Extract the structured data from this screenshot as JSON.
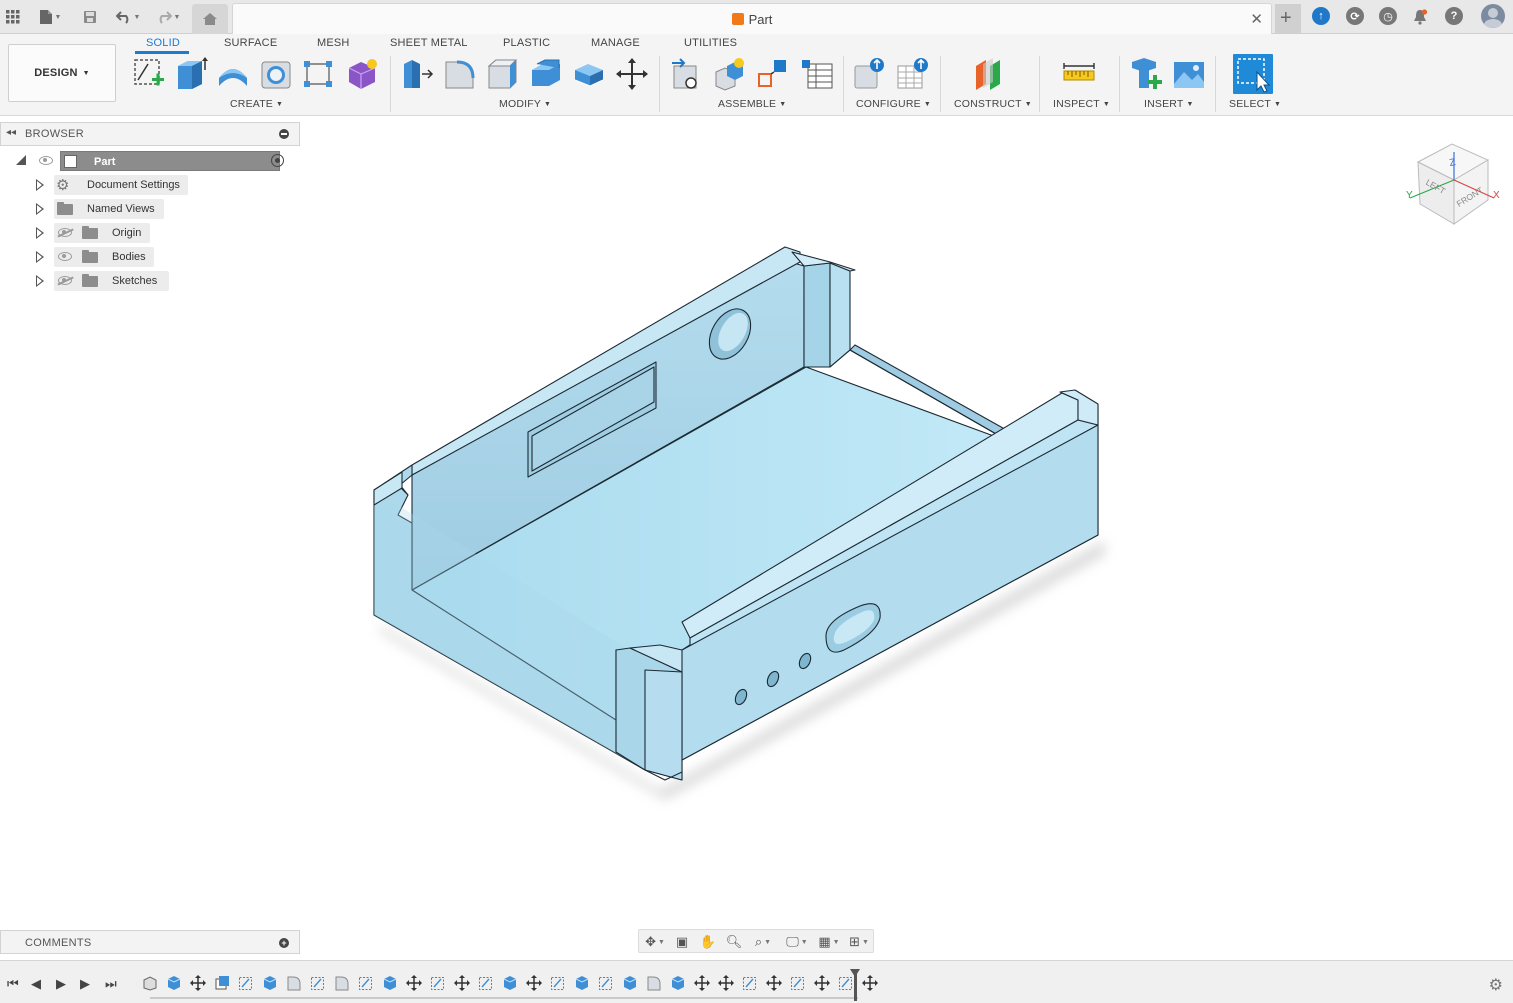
{
  "app": {
    "document_title": "Part"
  },
  "top_bar": {
    "icons": [
      "apps-grid-icon",
      "file-icon",
      "save-icon",
      "undo-icon",
      "redo-icon",
      "home-icon",
      "new-tab-icon",
      "job-status-icon",
      "extensions-icon",
      "history-icon",
      "notifications-icon",
      "help-icon",
      "user-avatar-icon"
    ]
  },
  "toolbar": {
    "workspace_button": "DESIGN",
    "tabs": [
      "SOLID",
      "SURFACE",
      "MESH",
      "SHEET METAL",
      "PLASTIC",
      "MANAGE",
      "UTILITIES"
    ],
    "active_tab": "SOLID",
    "groups": [
      {
        "label": "CREATE",
        "tools": [
          "create-sketch-icon",
          "extrude-icon",
          "revolve-icon",
          "hole-icon",
          "pattern-icon",
          "create-form-icon"
        ]
      },
      {
        "label": "MODIFY",
        "tools": [
          "press-pull-icon",
          "fillet-icon",
          "chamfer-icon",
          "shell-icon",
          "combine-icon",
          "move-icon"
        ]
      },
      {
        "label": "ASSEMBLE",
        "tools": [
          "new-component-icon",
          "joint-icon",
          "as-built-joint-icon",
          "bill-of-materials-icon"
        ]
      },
      {
        "label": "CONFIGURE",
        "tools": [
          "configure-icon",
          "configure-table-icon"
        ]
      },
      {
        "label": "CONSTRUCT",
        "tools": [
          "offset-plane-icon"
        ]
      },
      {
        "label": "INSPECT",
        "tools": [
          "measure-icon"
        ]
      },
      {
        "label": "INSERT",
        "tools": [
          "insert-derive-icon",
          "insert-canvas-icon"
        ]
      },
      {
        "label": "SELECT",
        "tools": [
          "select-icon"
        ]
      }
    ]
  },
  "browser": {
    "header": "BROWSER",
    "root": "Part",
    "items": [
      {
        "label": "Document Settings",
        "icon": "gear-icon",
        "visibility": "none"
      },
      {
        "label": "Named Views",
        "icon": "folder-icon",
        "visibility": "none"
      },
      {
        "label": "Origin",
        "icon": "folder-icon",
        "visibility": "hidden"
      },
      {
        "label": "Bodies",
        "icon": "folder-icon",
        "visibility": "visible"
      },
      {
        "label": "Sketches",
        "icon": "folder-icon",
        "visibility": "hidden"
      }
    ]
  },
  "comments": {
    "header": "COMMENTS"
  },
  "viewcube": {
    "faces": [
      "LEFT",
      "FRONT"
    ],
    "axes": [
      "Z",
      "Y",
      "X"
    ]
  },
  "colors": {
    "model_fill": "#b5def0",
    "model_edge": "#1c2a33",
    "accent": "#1a7bd0"
  }
}
